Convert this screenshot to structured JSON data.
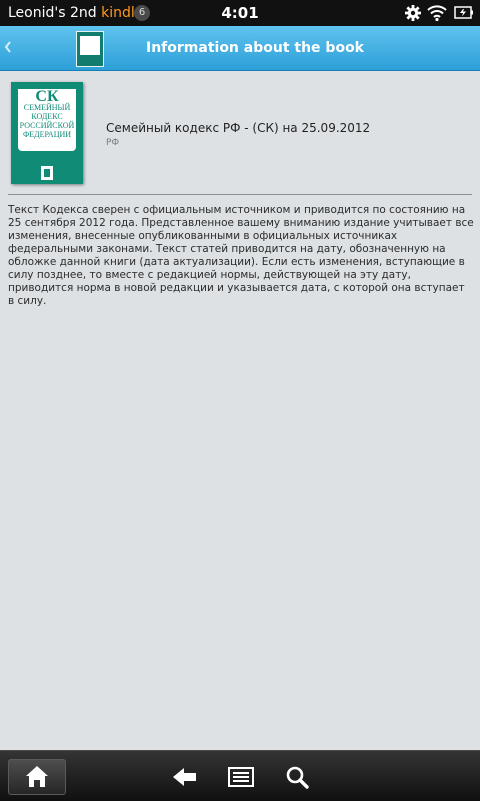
{
  "status_bar": {
    "device_name": "Leonid's 2nd",
    "device_brand": "kindle",
    "notification_count": "6",
    "time": "4:01",
    "icons": [
      "gear-icon",
      "wifi-icon",
      "battery-icon"
    ]
  },
  "title_bar": {
    "title": "Information about the book",
    "icons": [
      "chevron-left-icon"
    ]
  },
  "book": {
    "cover_abbreviation": "СК",
    "cover_title": "Семейный кодекс Российской Федерации",
    "title": "Семейный кодекс РФ - (СК) на 25.09.2012",
    "author": "РФ",
    "description": "Текст Кодекса сверен с официальным источником и приводится по состоянию на 25 сентября 2012 года. Представленное вашему вниманию издание учитывает все изменения, внесенные опубликованными в официальных источниках федеральными законами. Текст статей приводится на дату, обозначенную на обложке данной книги (дата актуализации). Если есть изменения, вступающие в силу позднее, то вместе с редакцией нормы, действующей на эту дату, приводится норма в новой редакции и указывается дата, с которой она вступает в силу."
  },
  "bottom_bar": {
    "icons": [
      "home-icon",
      "back-arrow-icon",
      "menu-icon",
      "search-icon"
    ]
  },
  "colors": {
    "title_bar": "#2d9fd8",
    "background": "#dde1e4",
    "cover": "#0f8b76",
    "kindle_brand": "#ff9a1f"
  }
}
